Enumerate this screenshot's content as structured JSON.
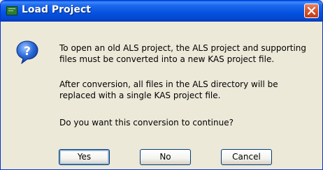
{
  "window": {
    "title": "Load Project"
  },
  "icons": {
    "title_icon": "application-icon",
    "message_icon": "question-icon",
    "close_icon": "close-icon"
  },
  "message": {
    "line1": "To open an old ALS project, the ALS project and supporting\nfiles must be converted into a new KAS project file.",
    "line2": "After conversion, all files in the ALS directory will be\nreplaced with a single KAS project file.",
    "line3": "Do you want this conversion to continue?"
  },
  "buttons": {
    "yes": "Yes",
    "no": "No",
    "cancel": "Cancel"
  }
}
